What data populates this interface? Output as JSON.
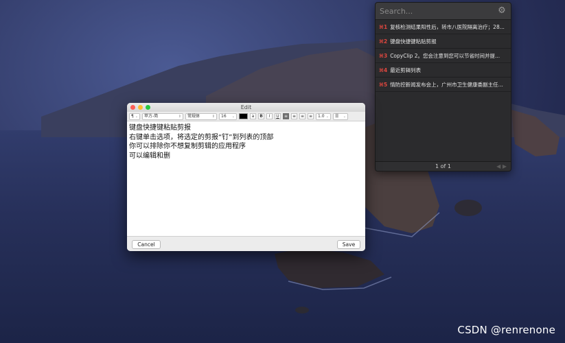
{
  "clipboard_panel": {
    "search_placeholder": "Search...",
    "settings_icon": "gear-icon",
    "items": [
      {
        "key": "⌘1",
        "text": "复核检测结果阳性后，转市八医院隔离治疗；28..."
      },
      {
        "key": "⌘2",
        "text": "键盘快捷键粘贴剪报"
      },
      {
        "key": "⌘3",
        "text": "CopyClip 2。您会注意到您可以节省时间并提..."
      },
      {
        "key": "⌘4",
        "text": "最近剪辑列表"
      },
      {
        "key": "⌘5",
        "text": "情防控新闻发布会上，广州市卫生健康委副主任..."
      }
    ],
    "page_indicator": "1 of 1"
  },
  "edit_window": {
    "title": "Edit",
    "toolbar": {
      "paragraph": "¶",
      "font_family": "苹方-简",
      "font_style": "常规体",
      "font_size": "16",
      "text_color": "#000000",
      "bold": "B",
      "italic": "I",
      "underline": "U",
      "line_spacing": "1.0"
    },
    "lines": [
      "键盘快捷键粘贴剪报",
      "右键单击选项，将选定的剪报“钉”到列表的顶部",
      "你可以排除你不想复制剪辑的应用程序",
      "可以编辑和删"
    ],
    "cancel_label": "Cancel",
    "save_label": "Save"
  },
  "watermark": "CSDN @renrenone"
}
